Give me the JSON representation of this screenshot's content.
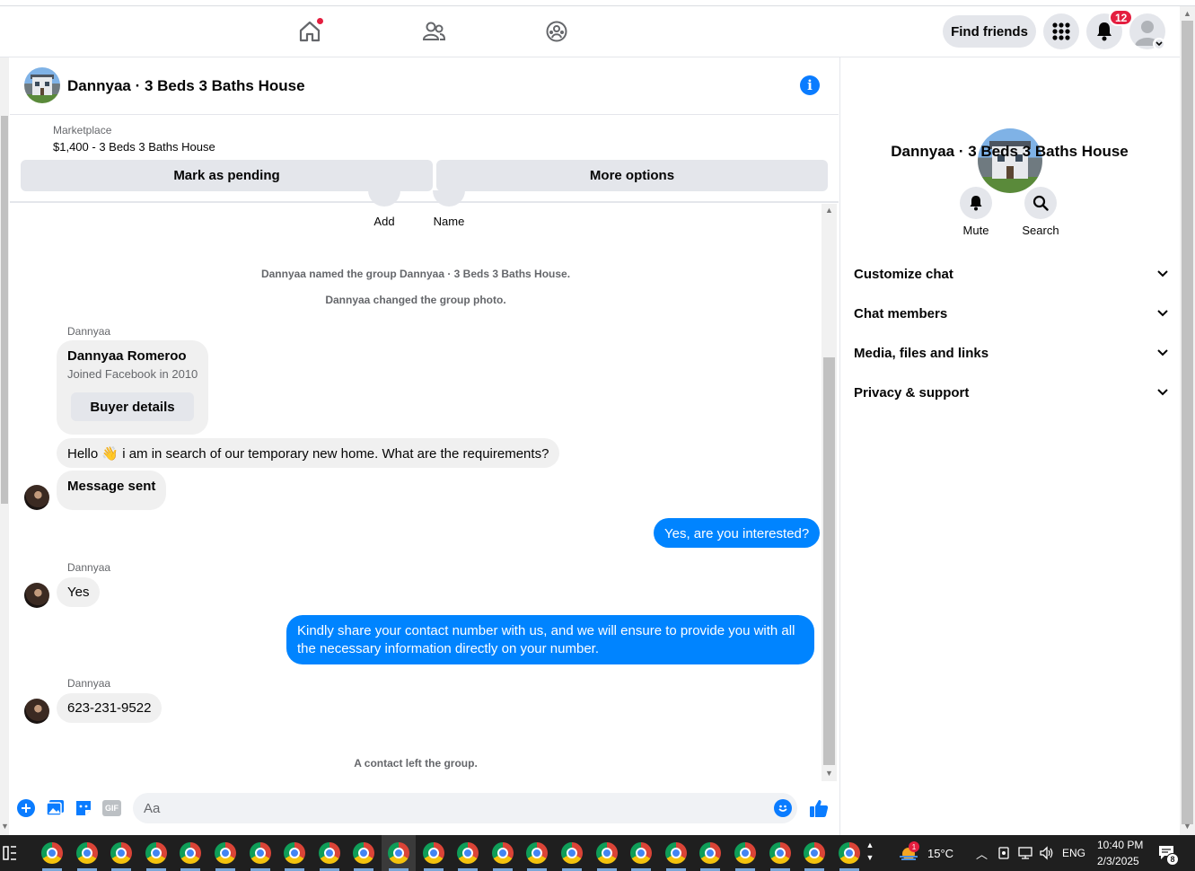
{
  "topnav": {
    "find_friends": "Find friends",
    "notification_count": "12"
  },
  "chat": {
    "title": "Dannyaa · 3 Beds 3 Baths House",
    "marketplace_label": "Marketplace",
    "listing": "$1,400 - 3 Beds 3 Baths House",
    "mark_pending": "Mark as pending",
    "more_options": "More options",
    "add_label": "Add",
    "name_label": "Name",
    "system_rename": "Dannyaa named the group Dannyaa · 3 Beds 3 Baths House.",
    "system_photo": "Dannyaa changed the group photo.",
    "sender1": "Dannyaa",
    "buyer_name": "Dannyaa Romeroo",
    "buyer_joined": "Joined Facebook in 2010",
    "buyer_details": "Buyer details",
    "msg_hello": "Hello 👋 i am in search of our temporary new home.  What are the requirements?",
    "msg_sent": "Message sent",
    "msg_interested": "Yes, are you interested?",
    "sender2": "Dannyaa",
    "msg_yes": "Yes",
    "msg_share_line1": "Kindly share your contact number with us, and we will ensure to provide you with all",
    "msg_share_line2": "the necessary information directly on your number.",
    "sender3": "Dannyaa",
    "msg_phone": "623-231-9522",
    "system_left": "A contact left the group.",
    "composer_placeholder": "Aa"
  },
  "right_panel": {
    "title": "Dannyaa · 3 Beds 3 Baths House",
    "mute": "Mute",
    "search": "Search",
    "sections": [
      "Customize chat",
      "Chat members",
      "Media, files and links",
      "Privacy & support"
    ]
  },
  "taskbar": {
    "weather_badge": "1",
    "temperature": "15°C",
    "language": "ENG",
    "time": "10:40 PM",
    "date": "2/3/2025",
    "notif_count": "8"
  },
  "colors": {
    "accent": "#0084ff",
    "badge_red": "#e41e3f",
    "taskbar": "#1f1f1f"
  }
}
